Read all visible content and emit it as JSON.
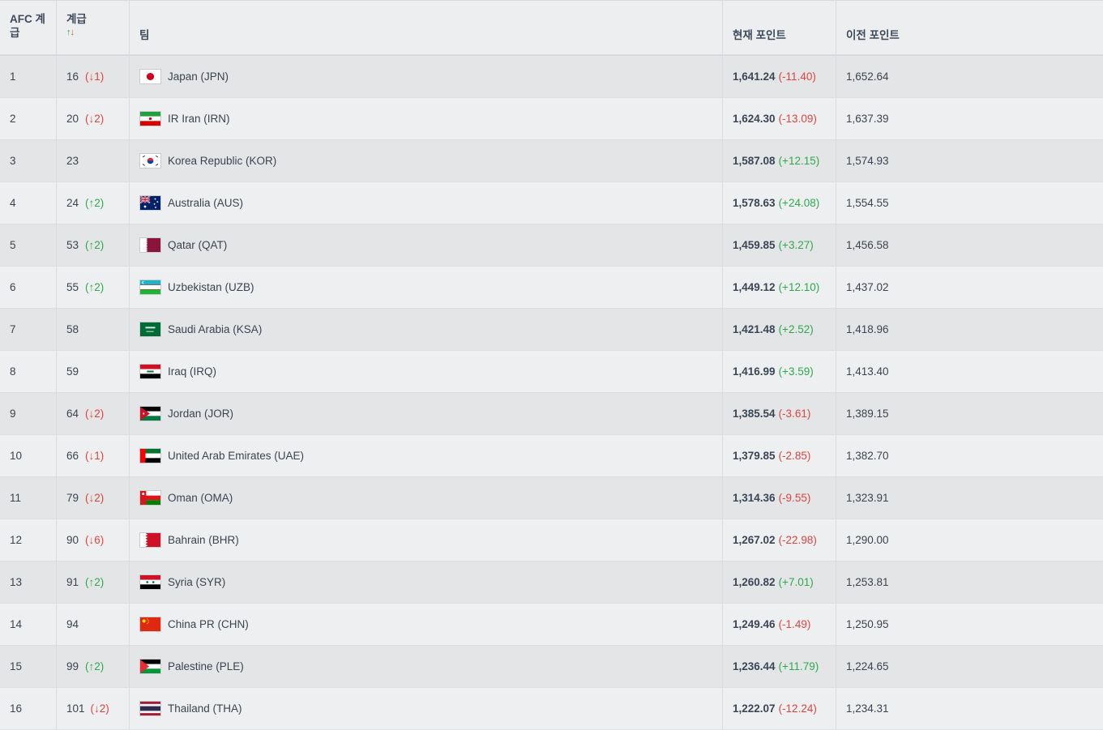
{
  "header": {
    "afc_rank": "AFC 계급",
    "world_rank": "계급",
    "sort_icon_up": "↑",
    "sort_icon_down": "↓",
    "team": "팀",
    "current_points": "현재 포인트",
    "previous_points": "이전 포인트"
  },
  "colors": {
    "positive": "#2eaa4c",
    "negative": "#e0443e"
  },
  "rows": [
    {
      "afc": "1",
      "world": "16",
      "move": "(↓1)",
      "dir": "down",
      "flag": "jpn-flag-icon",
      "team": "Japan (JPN)",
      "points": "1,641.24",
      "change": "(-11.40)",
      "sign": "neg",
      "prev": "1,652.64"
    },
    {
      "afc": "2",
      "world": "20",
      "move": "(↓2)",
      "dir": "down",
      "flag": "irn-flag-icon",
      "team": "IR Iran (IRN)",
      "points": "1,624.30",
      "change": "(-13.09)",
      "sign": "neg",
      "prev": "1,637.39"
    },
    {
      "afc": "3",
      "world": "23",
      "move": "",
      "dir": "",
      "flag": "kor-flag-icon",
      "team": "Korea Republic (KOR)",
      "points": "1,587.08",
      "change": "(+12.15)",
      "sign": "pos",
      "prev": "1,574.93"
    },
    {
      "afc": "4",
      "world": "24",
      "move": "(↑2)",
      "dir": "up",
      "flag": "aus-flag-icon",
      "team": "Australia (AUS)",
      "points": "1,578.63",
      "change": "(+24.08)",
      "sign": "pos",
      "prev": "1,554.55"
    },
    {
      "afc": "5",
      "world": "53",
      "move": "(↑2)",
      "dir": "up",
      "flag": "qat-flag-icon",
      "team": "Qatar (QAT)",
      "points": "1,459.85",
      "change": "(+3.27)",
      "sign": "pos",
      "prev": "1,456.58"
    },
    {
      "afc": "6",
      "world": "55",
      "move": "(↑2)",
      "dir": "up",
      "flag": "uzb-flag-icon",
      "team": "Uzbekistan (UZB)",
      "points": "1,449.12",
      "change": "(+12.10)",
      "sign": "pos",
      "prev": "1,437.02"
    },
    {
      "afc": "7",
      "world": "58",
      "move": "",
      "dir": "",
      "flag": "ksa-flag-icon",
      "team": "Saudi Arabia (KSA)",
      "points": "1,421.48",
      "change": "(+2.52)",
      "sign": "pos",
      "prev": "1,418.96"
    },
    {
      "afc": "8",
      "world": "59",
      "move": "",
      "dir": "",
      "flag": "irq-flag-icon",
      "team": "Iraq (IRQ)",
      "points": "1,416.99",
      "change": "(+3.59)",
      "sign": "pos",
      "prev": "1,413.40"
    },
    {
      "afc": "9",
      "world": "64",
      "move": "(↓2)",
      "dir": "down",
      "flag": "jor-flag-icon",
      "team": "Jordan (JOR)",
      "points": "1,385.54",
      "change": "(-3.61)",
      "sign": "neg",
      "prev": "1,389.15"
    },
    {
      "afc": "10",
      "world": "66",
      "move": "(↓1)",
      "dir": "down",
      "flag": "uae-flag-icon",
      "team": "United Arab Emirates (UAE)",
      "points": "1,379.85",
      "change": "(-2.85)",
      "sign": "neg",
      "prev": "1,382.70"
    },
    {
      "afc": "11",
      "world": "79",
      "move": "(↓2)",
      "dir": "down",
      "flag": "oma-flag-icon",
      "team": "Oman (OMA)",
      "points": "1,314.36",
      "change": "(-9.55)",
      "sign": "neg",
      "prev": "1,323.91"
    },
    {
      "afc": "12",
      "world": "90",
      "move": "(↓6)",
      "dir": "down",
      "flag": "bhr-flag-icon",
      "team": "Bahrain (BHR)",
      "points": "1,267.02",
      "change": "(-22.98)",
      "sign": "neg",
      "prev": "1,290.00"
    },
    {
      "afc": "13",
      "world": "91",
      "move": "(↑2)",
      "dir": "up",
      "flag": "syr-flag-icon",
      "team": "Syria (SYR)",
      "points": "1,260.82",
      "change": "(+7.01)",
      "sign": "pos",
      "prev": "1,253.81"
    },
    {
      "afc": "14",
      "world": "94",
      "move": "",
      "dir": "",
      "flag": "chn-flag-icon",
      "team": "China PR (CHN)",
      "points": "1,249.46",
      "change": "(-1.49)",
      "sign": "neg",
      "prev": "1,250.95"
    },
    {
      "afc": "15",
      "world": "99",
      "move": "(↑2)",
      "dir": "up",
      "flag": "ple-flag-icon",
      "team": "Palestine (PLE)",
      "points": "1,236.44",
      "change": "(+11.79)",
      "sign": "pos",
      "prev": "1,224.65"
    },
    {
      "afc": "16",
      "world": "101",
      "move": "(↓2)",
      "dir": "down",
      "flag": "tha-flag-icon",
      "team": "Thailand (THA)",
      "points": "1,222.07",
      "change": "(-12.24)",
      "sign": "neg",
      "prev": "1,234.31"
    }
  ]
}
